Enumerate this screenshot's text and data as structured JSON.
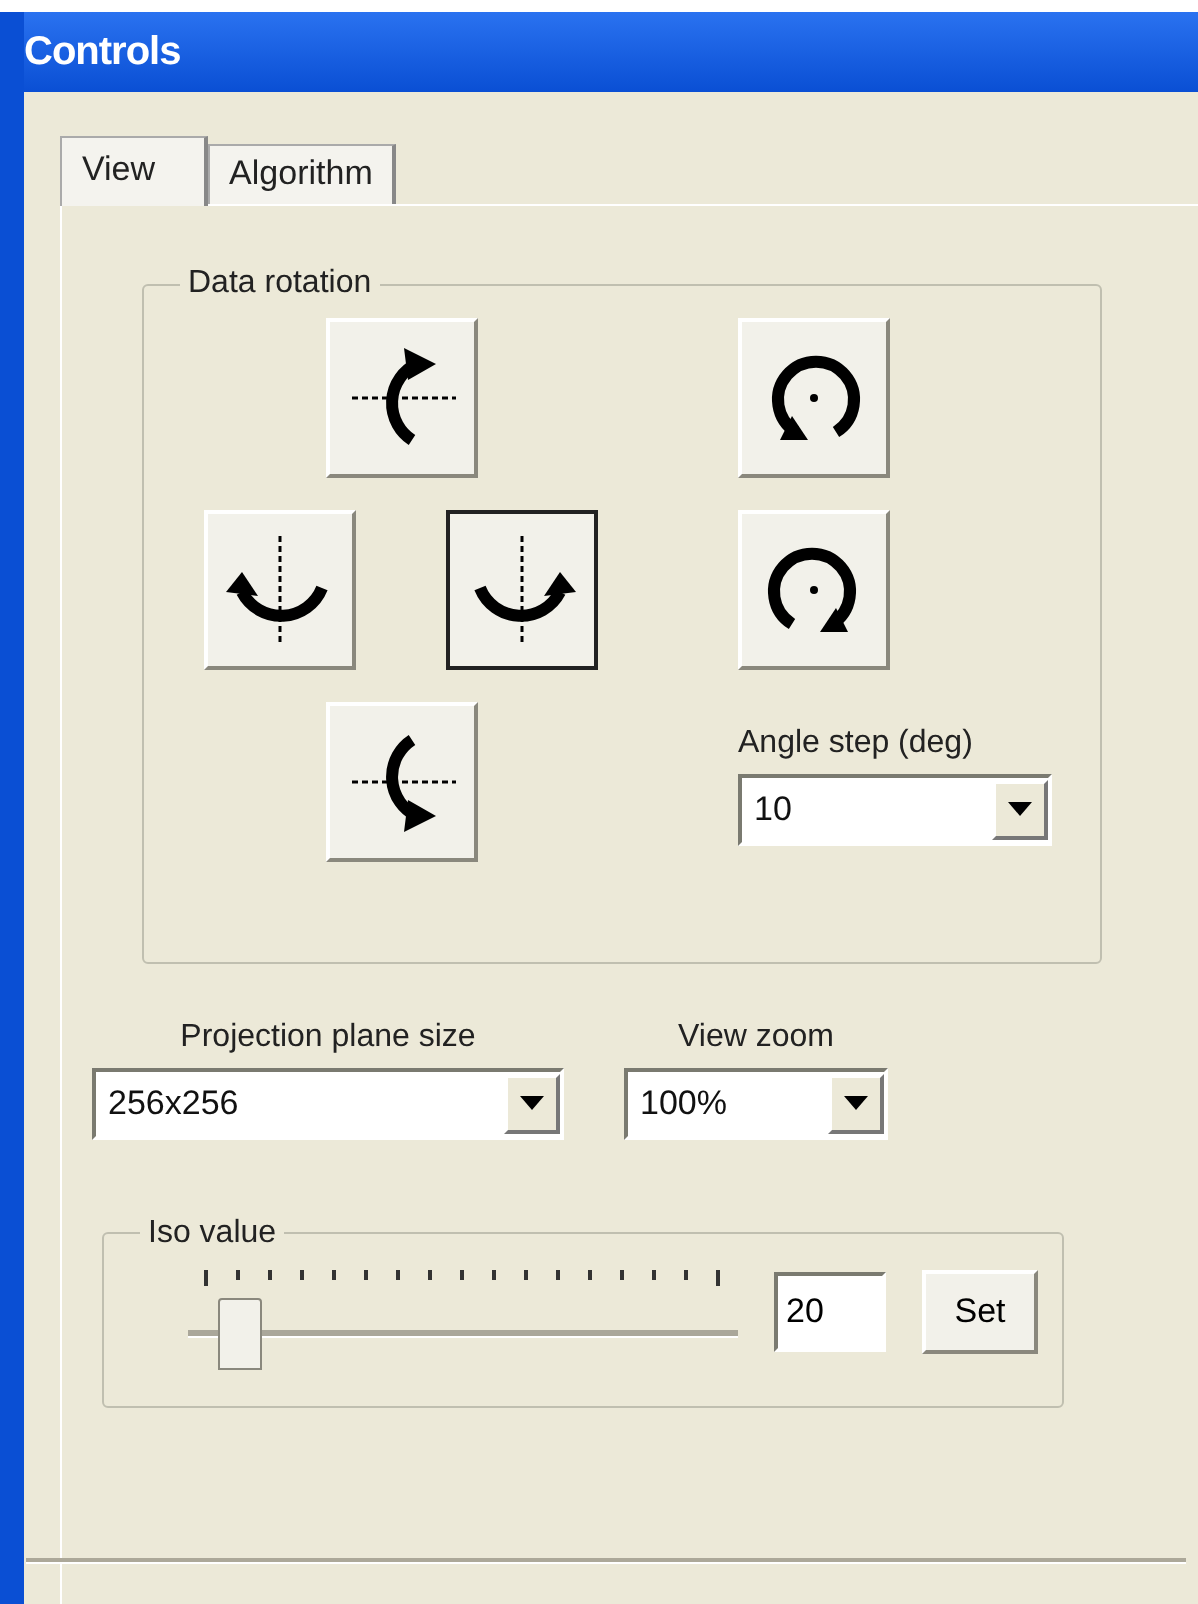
{
  "window": {
    "title": "Controls"
  },
  "tabs": [
    {
      "label": "View",
      "selected": true
    },
    {
      "label": "Algorithm",
      "selected": false
    }
  ],
  "rotation": {
    "title": "Data rotation",
    "buttons": [
      {
        "kind": "pitch-up",
        "focused": false
      },
      {
        "kind": "yaw-left",
        "focused": false
      },
      {
        "kind": "yaw-right",
        "focused": true
      },
      {
        "kind": "pitch-down",
        "focused": false
      },
      {
        "kind": "roll-ccw",
        "focused": false
      },
      {
        "kind": "roll-cw",
        "focused": false
      }
    ],
    "angle_step": {
      "label": "Angle step (deg)",
      "value": "10"
    }
  },
  "projection": {
    "label": "Projection plane size",
    "value": "256x256"
  },
  "zoom": {
    "label": "View zoom",
    "value": "100%"
  },
  "iso": {
    "title": "Iso value",
    "level": 0.06,
    "value": "20",
    "button": "Set"
  }
}
